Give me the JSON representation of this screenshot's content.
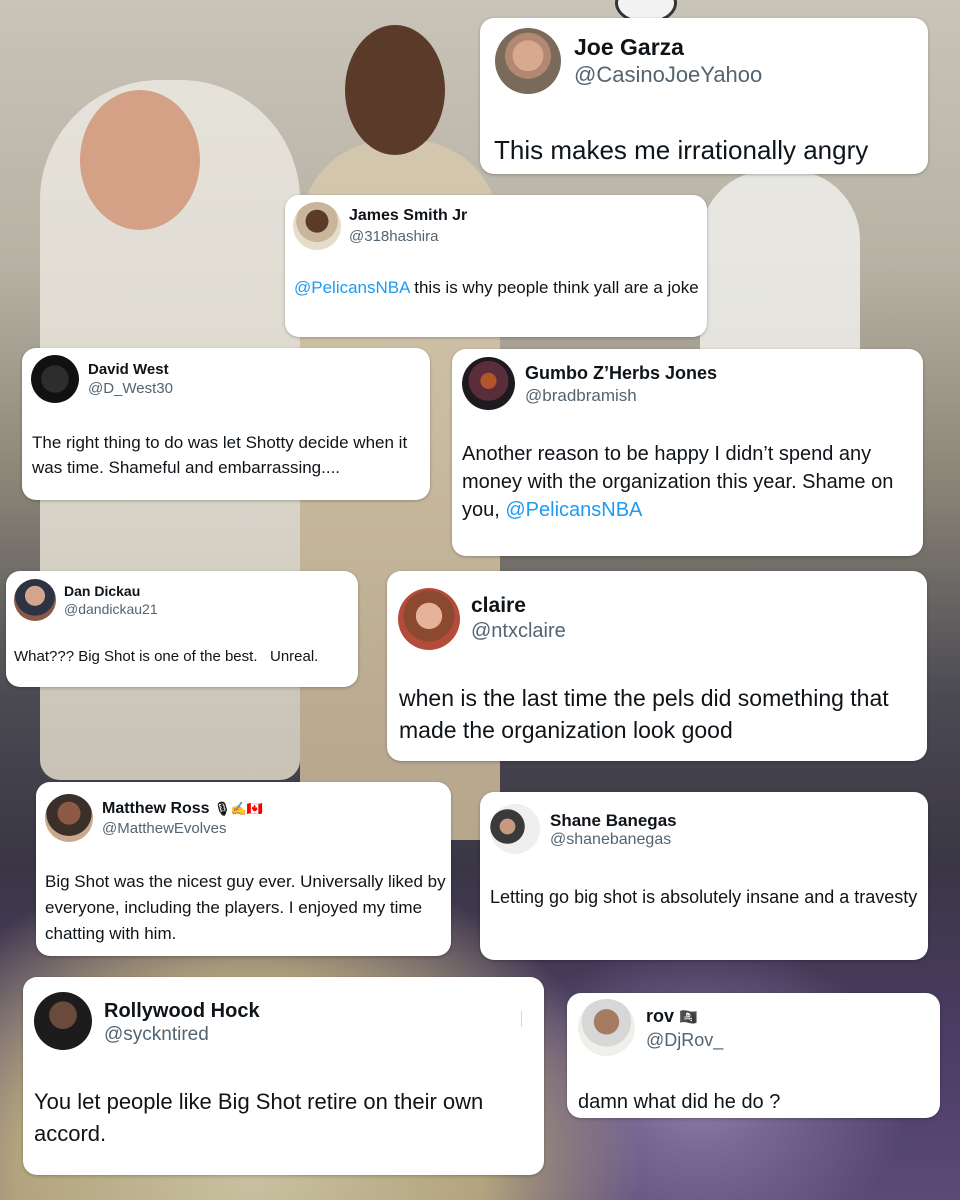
{
  "tweets": [
    {
      "name": "Joe Garza",
      "handle": "@CasinoJoeYahoo",
      "text": "This makes me irrationally angry"
    },
    {
      "name": "James Smith Jr",
      "handle": "@318hashira",
      "mention": "@PelicansNBA",
      "text": " this is why people think yall are a joke"
    },
    {
      "name": "David West",
      "handle": "@D_West30",
      "text": "The right thing to do was let Shotty decide when it was time. Shameful and embarrassing...."
    },
    {
      "name": "Gumbo Z’Herbs Jones",
      "handle": "@bradbramish",
      "text": "Another reason to be happy I didn’t spend any money with the organization this year. Shame on you, ",
      "mention": "@PelicansNBA"
    },
    {
      "name": "Dan Dickau",
      "handle": "@dandickau21",
      "text": "What??? Big Shot is one of the best.   Unreal."
    },
    {
      "name": "claire",
      "handle": "@ntxclaire",
      "text": "when is the last time the pels did something that made the organization look good"
    },
    {
      "name": "Matthew Ross",
      "name_emoji": "🎙✍🇨🇦",
      "handle": "@MatthewEvolves",
      "text": "Big Shot was the nicest guy ever. Universally liked by everyone, including the players. I enjoyed my time chatting with him."
    },
    {
      "name": "Shane Banegas",
      "handle": "@shanebanegas",
      "text": "Letting go big shot is absolutely insane and a travesty"
    },
    {
      "name": "Rollywood Hock",
      "handle": "@syckntired",
      "text": "You let people like Big Shot retire on their own accord."
    },
    {
      "name": "rov",
      "name_emoji": "🏴‍☠️",
      "handle": "@DjRov_",
      "text": "damn what did he do ?"
    }
  ],
  "colors": {
    "text": "#0f1419",
    "handle": "#536471",
    "link": "#1d9bf0",
    "card": "#ffffff"
  }
}
